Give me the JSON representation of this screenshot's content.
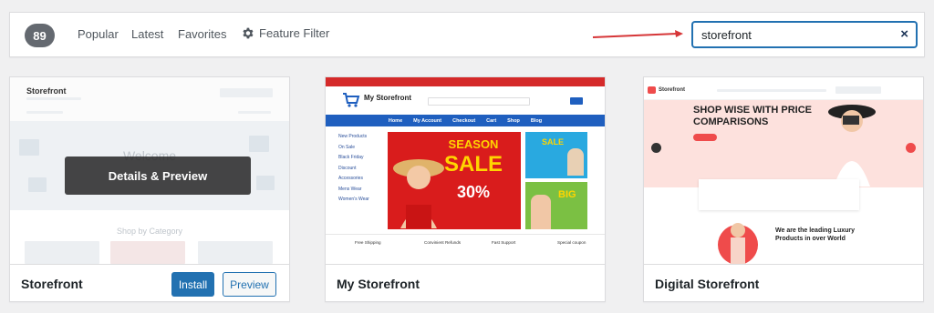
{
  "filter_bar": {
    "count": "89",
    "tabs": [
      "Popular",
      "Latest",
      "Favorites"
    ],
    "feature_filter": "Feature Filter",
    "search_value": "storefront",
    "clear_icon": "×"
  },
  "themes": [
    {
      "name": "Storefront",
      "install_label": "Install",
      "preview_label": "Preview",
      "overlay_label": "Details & Preview",
      "screenshot": {
        "logo": "Storefront",
        "welcome": "Welcome",
        "shop": "Shop by Category"
      }
    },
    {
      "name": "My Storefront",
      "screenshot": {
        "logo": "My Storefront",
        "nav": [
          "Home",
          "My Account",
          "Checkout",
          "Cart",
          "Shop",
          "Blog"
        ],
        "side": [
          "New Products",
          "On Sale",
          "Black Friday",
          "Discount",
          "Accessories",
          "Mens Wear",
          "Women's Wear"
        ],
        "sale_top": "SEASON",
        "sale_main": "SALE",
        "sale_pct": "30%",
        "features": [
          "Free Shipping",
          "Convinient Refunds",
          "Fast Support",
          "Special coupon"
        ]
      }
    },
    {
      "name": "Digital Storefront",
      "screenshot": {
        "logo": "Storefront",
        "headline_1": "SHOP WISE WITH PRICE",
        "headline_2": "COMPARISONS",
        "sub_1": "We are the leading Luxury",
        "sub_2": "Products in over World"
      }
    }
  ],
  "colors": {
    "accent": "#2271b1",
    "count_badge": "#646970",
    "arrow": "#d63638"
  }
}
